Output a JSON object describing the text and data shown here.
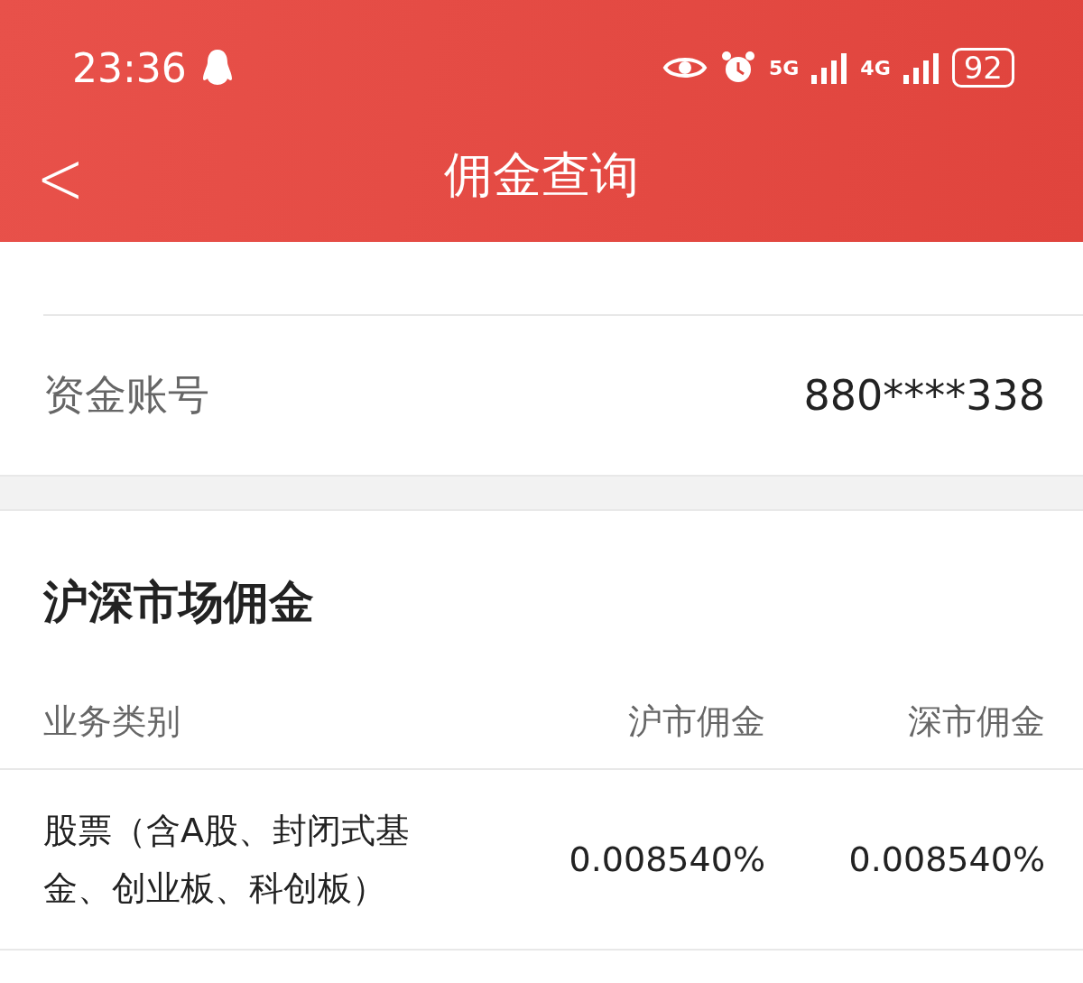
{
  "status_bar": {
    "time": "23:36",
    "network_1": "5G",
    "network_2": "4G",
    "battery": "92"
  },
  "header": {
    "back": "<",
    "title": "佣金查询"
  },
  "account": {
    "rows": [
      {
        "label": "资金账号",
        "value": "880****338"
      }
    ]
  },
  "commission": {
    "title": "沪深市场佣金",
    "columns": [
      "业务类别",
      "沪市佣金",
      "深市佣金"
    ],
    "rows": [
      {
        "category": "股票（含A股、封闭式基金、创业板、科创板）",
        "sh": "0.008540%",
        "sz": "0.008540%"
      }
    ]
  }
}
